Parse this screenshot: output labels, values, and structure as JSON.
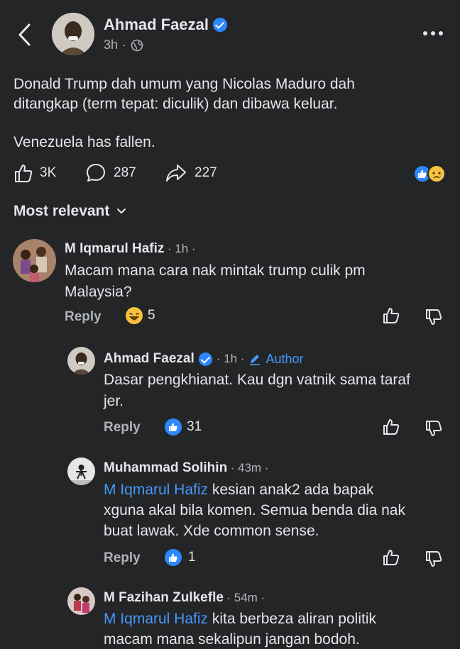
{
  "post": {
    "author": "Ahmad Faezal",
    "time": "3h",
    "time_separator": "·",
    "text_line1": "Donald Trump dah umum yang Nicolas Maduro dah",
    "text_line2": "ditangkap (term tepat: diculik) dan dibawa keluar.",
    "text_line3": "Venezuela has fallen.",
    "likes": "3K",
    "comments": "287",
    "shares": "227"
  },
  "sort": {
    "label": "Most relevant"
  },
  "comments": [
    {
      "name": "M Iqmarul Hafiz",
      "meta": "· 1h ·",
      "line1": "Macam mana cara nak mintak trump culik pm",
      "line2": "Malaysia?",
      "reply": "Reply",
      "reaction_count": "5"
    },
    {
      "name": "Ahmad Faezal",
      "meta": "· 1h ·",
      "author_badge": "Author",
      "line1": "Dasar pengkhianat. Kau dgn vatnik sama taraf",
      "line2": "jer.",
      "reply": "Reply",
      "reaction_count": "31"
    },
    {
      "name": "Muhammad Solihin",
      "meta": "· 43m ·",
      "mention": "M Iqmarul Hafiz",
      "line1": " kesian anak2 ada bapak",
      "line2": "xguna akal bila komen. Semua benda dia nak",
      "line3": "buat lawak. Xde common sense.",
      "reply": "Reply",
      "reaction_count": "1"
    },
    {
      "name": "M Fazihan Zulkefle",
      "meta": "· 54m ·",
      "mention": "M Iqmarul Hafiz",
      "line1": " kita berbeza aliran politik",
      "line2": "macam mana sekalipun jangan bodoh."
    }
  ],
  "colors": {
    "background": "#242526",
    "text": "#e4e6eb",
    "muted": "#b0b3b8",
    "link": "#4599ff",
    "like_blue": "#2d88ff"
  },
  "icons": [
    "back-chevron-icon",
    "verified-icon",
    "globe-icon",
    "more-icon",
    "like-icon",
    "comment-icon",
    "share-icon",
    "reaction-like-icon",
    "reaction-sad-icon",
    "chevron-down-icon",
    "pencil-icon",
    "reaction-laugh-icon",
    "thumbs-up-icon",
    "thumbs-down-icon"
  ]
}
